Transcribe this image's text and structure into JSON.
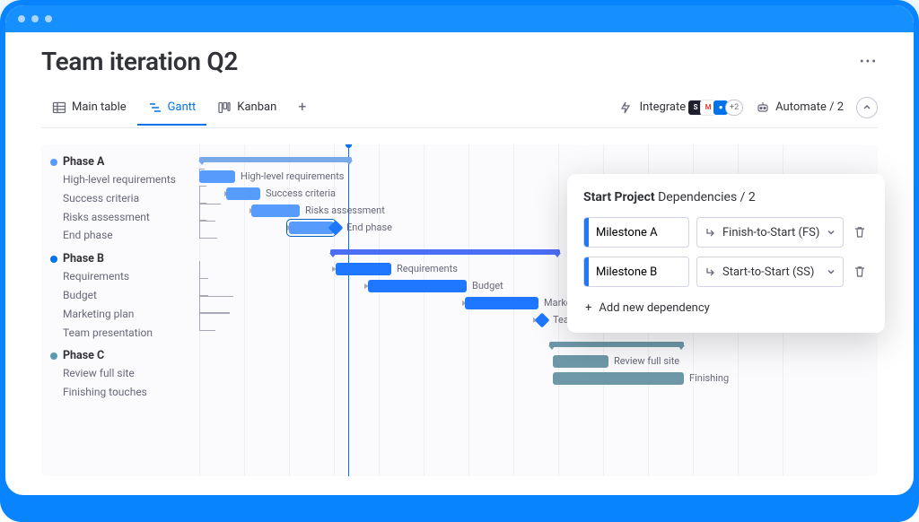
{
  "header": {
    "title": "Team iteration Q2"
  },
  "tabs": {
    "items": [
      {
        "label": "Main table"
      },
      {
        "label": "Gantt"
      },
      {
        "label": "Kanban"
      }
    ]
  },
  "toolbar": {
    "integrate_label": "Integrate",
    "integrate_extra": "+2",
    "automate_label": "Automate / 2"
  },
  "phases": {
    "a": {
      "title": "Phase A",
      "tasks": [
        "High-level requirements",
        "Success criteria",
        "Risks assessment",
        "End phase"
      ]
    },
    "b": {
      "title": "Phase B",
      "tasks": [
        "Requirements",
        "Budget",
        "Marketing plan",
        "Team presentation"
      ]
    },
    "c": {
      "title": "Phase C",
      "tasks": [
        "Review full site",
        "Finishing touches"
      ]
    }
  },
  "bar_labels": {
    "hlr": "High-level requirements",
    "sc": "Success criteria",
    "ra": "Risks assessment",
    "ep": "End phase",
    "req": "Requirements",
    "bud": "Budget",
    "mkt": "Marketing plan",
    "tp": "Team presentation",
    "rfs": "Review full site",
    "fin": "Finishing"
  },
  "panel": {
    "subject": "Start Project",
    "title_rest": "Dependencies / 2",
    "deps": [
      {
        "name": "Milestone A",
        "type_label": "Finish-to-Start (FS)"
      },
      {
        "name": "Milestone B",
        "type_label": "Start-to-Start (SS)"
      }
    ],
    "add_label": "Add new dependency"
  },
  "chart_data": {
    "type": "gantt",
    "time_unit": "generic",
    "today_marker": 166,
    "groups": [
      {
        "id": "A",
        "name": "Phase A",
        "color": "#579bfc",
        "summary": {
          "start": 0,
          "end": 170
        },
        "tasks": [
          {
            "name": "High-level requirements",
            "start": 0,
            "end": 40
          },
          {
            "name": "Success criteria",
            "start": 30,
            "end": 68
          },
          {
            "name": "Risks assessment",
            "start": 58,
            "end": 112
          },
          {
            "name": "End phase",
            "start": 100,
            "end": 150,
            "milestone_at": 148
          }
        ]
      },
      {
        "id": "B",
        "name": "Phase B",
        "color": "#1f76ff",
        "summary": {
          "start": 146,
          "end": 402
        },
        "tasks": [
          {
            "name": "Requirements",
            "start": 152,
            "end": 214
          },
          {
            "name": "Budget",
            "start": 188,
            "end": 298
          },
          {
            "name": "Marketing plan",
            "start": 296,
            "end": 378
          },
          {
            "name": "Team presentation",
            "milestone_at": 378
          }
        ]
      },
      {
        "id": "C",
        "name": "Phase C",
        "color": "#6e98a8",
        "summary": {
          "start": 390,
          "end": 540
        },
        "tasks": [
          {
            "name": "Review full site",
            "start": 394,
            "end": 456
          },
          {
            "name": "Finishing touches",
            "start": 394,
            "end": 540
          }
        ]
      }
    ],
    "dependencies": [
      {
        "from": "High-level requirements",
        "to": "Success criteria",
        "type": "FS"
      },
      {
        "from": "Success criteria",
        "to": "Risks assessment",
        "type": "FS"
      },
      {
        "from": "Risks assessment",
        "to": "End phase",
        "type": "FS"
      },
      {
        "from": "End phase",
        "to": "Requirements",
        "type": "FS"
      },
      {
        "from": "Requirements",
        "to": "Budget",
        "type": "FS"
      },
      {
        "from": "Budget",
        "to": "Marketing plan",
        "type": "FS"
      },
      {
        "from": "Marketing plan",
        "to": "Team presentation",
        "type": "FS"
      },
      {
        "from": "Team presentation",
        "to": "Review full site",
        "type": "FS"
      }
    ]
  }
}
